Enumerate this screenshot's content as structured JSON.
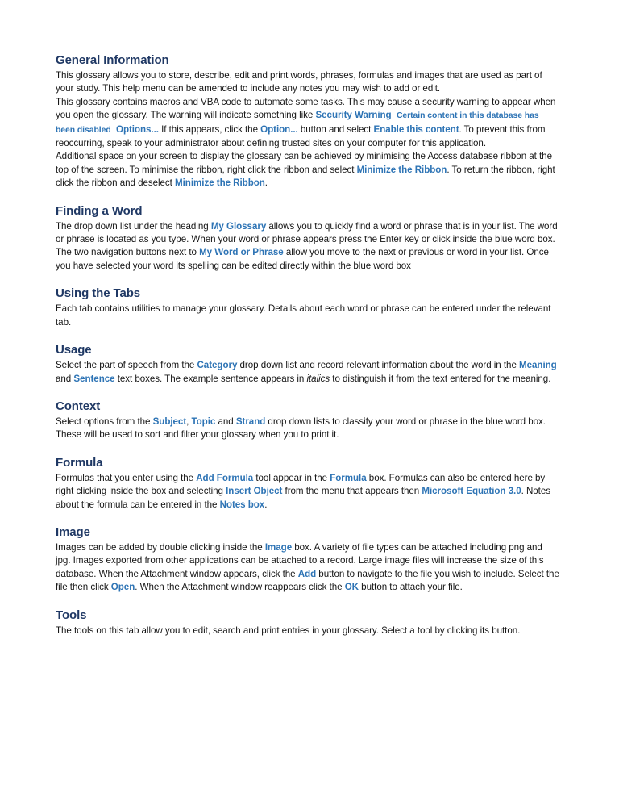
{
  "document": {
    "accent_color": "#2E74B5",
    "heading_color": "#1F3864",
    "body_color": "#161616",
    "background_color": "#FFFFFF",
    "sections": [
      {
        "heading": "General Information",
        "paragraphs": [
          {
            "runs": [
              {
                "text": "This glossary allows you to store, describe, edit and print words, phrases, formulas and images that are used as part of your study. This help menu can be amended to include any notes you may wish to add or edit.",
                "style": "normal"
              }
            ]
          },
          {
            "spaced": true,
            "runs": [
              {
                "text": "This glossary contains macros and VBA code to automate some tasks. This may cause a security warning to appear when you open the glossary. The warning will indicate something like ",
                "style": "normal"
              },
              {
                "text": "Security Warning",
                "style": "accent"
              },
              {
                "text": "  ",
                "style": "normal"
              },
              {
                "text": "Certain content in this database has been disabled",
                "style": "accent-small"
              },
              {
                "text": "  ",
                "style": "normal"
              },
              {
                "text": "Options...",
                "style": "accent"
              },
              {
                "text": " If this appears, click the ",
                "style": "normal"
              },
              {
                "text": "Option...",
                "style": "accent"
              },
              {
                "text": " button and select ",
                "style": "normal"
              },
              {
                "text": "Enable this content",
                "style": "accent"
              },
              {
                "text": ". To prevent this from reoccurring, speak to your administrator about defining trusted sites on your computer for this application.",
                "style": "normal"
              }
            ]
          },
          {
            "spaced": true,
            "runs": [
              {
                "text": "Additional space on your screen to display the glossary can be achieved by minimising the Access database ribbon at the top of the screen. To minimise the ribbon, right click the ribbon and select ",
                "style": "normal"
              },
              {
                "text": "Minimize the Ribbon",
                "style": "accent"
              },
              {
                "text": ". To return the ribbon, right click the ribbon and deselect ",
                "style": "normal"
              },
              {
                "text": "Minimize the Ribbon",
                "style": "accent"
              },
              {
                "text": ".",
                "style": "normal"
              }
            ]
          }
        ]
      },
      {
        "heading": "Finding a Word",
        "paragraphs": [
          {
            "runs": [
              {
                "text": "The drop down list under the heading ",
                "style": "normal"
              },
              {
                "text": "My Glossary",
                "style": "accent"
              },
              {
                "text": " allows you to quickly find a word or phrase that is in your list. The word or phrase is located as you type. When your word or phrase appears press the Enter key or click inside the blue word box. The two navigation buttons next to ",
                "style": "normal"
              },
              {
                "text": "My Word or Phrase",
                "style": "accent"
              },
              {
                "text": " allow you move to the next or previous or word in your list. Once you have selected your word its spelling can be edited directly within the blue word box",
                "style": "normal"
              }
            ]
          }
        ]
      },
      {
        "heading": "Using the Tabs",
        "paragraphs": [
          {
            "runs": [
              {
                "text": "Each tab contains utilities to manage your glossary. Details about each word or phrase can be entered under the relevant tab.",
                "style": "normal"
              }
            ]
          }
        ]
      },
      {
        "heading": "Usage",
        "paragraphs": [
          {
            "runs": [
              {
                "text": "Select the part of speech from the ",
                "style": "normal"
              },
              {
                "text": "Category",
                "style": "accent"
              },
              {
                "text": " drop down list and record relevant information about the word in the ",
                "style": "normal"
              },
              {
                "text": "Meaning",
                "style": "accent"
              },
              {
                "text": " and ",
                "style": "normal"
              },
              {
                "text": "Sentence",
                "style": "accent"
              },
              {
                "text": " text boxes. The example sentence appears in ",
                "style": "normal"
              },
              {
                "text": "italics",
                "style": "italic"
              },
              {
                "text": " to distinguish it from the text entered for the meaning.",
                "style": "normal"
              }
            ]
          }
        ]
      },
      {
        "heading": "Context",
        "paragraphs": [
          {
            "runs": [
              {
                "text": "Select options from the ",
                "style": "normal"
              },
              {
                "text": "Subject",
                "style": "accent"
              },
              {
                "text": ", ",
                "style": "normal"
              },
              {
                "text": "Topic",
                "style": "accent"
              },
              {
                "text": " and ",
                "style": "normal"
              },
              {
                "text": "Strand",
                "style": "accent"
              },
              {
                "text": " drop down lists to classify your word or phrase in the blue word box. These will be used to sort and filter your glossary when you to print it.",
                "style": "normal"
              }
            ]
          }
        ]
      },
      {
        "heading": "Formula",
        "paragraphs": [
          {
            "runs": [
              {
                "text": "Formulas that you enter using the ",
                "style": "normal"
              },
              {
                "text": "Add Formula",
                "style": "accent"
              },
              {
                "text": " tool appear in the ",
                "style": "normal"
              },
              {
                "text": "Formula",
                "style": "accent"
              },
              {
                "text": " box. Formulas can also be entered here by right clicking inside the box and selecting ",
                "style": "normal"
              },
              {
                "text": "Insert Object",
                "style": "accent"
              },
              {
                "text": " from the menu that appears then ",
                "style": "normal"
              },
              {
                "text": "Microsoft Equation 3.0",
                "style": "accent"
              },
              {
                "text": ". Notes about the formula can be entered in the ",
                "style": "normal"
              },
              {
                "text": "Notes box",
                "style": "accent"
              },
              {
                "text": ".",
                "style": "normal"
              }
            ]
          }
        ]
      },
      {
        "heading": "Image",
        "paragraphs": [
          {
            "runs": [
              {
                "text": "Images can be added by double clicking inside the ",
                "style": "normal"
              },
              {
                "text": "Image",
                "style": "accent"
              },
              {
                "text": " box. A variety of file types can be attached including png and jpg. Images exported from other applications can be attached to a record. Large image files will increase the size of this database. When the Attachment window appears, click the ",
                "style": "normal"
              },
              {
                "text": "Add",
                "style": "accent"
              },
              {
                "text": " button to navigate to the file you wish to include. Select the file then click ",
                "style": "normal"
              },
              {
                "text": "Open",
                "style": "accent"
              },
              {
                "text": ". When the Attachment window reappears click the ",
                "style": "normal"
              },
              {
                "text": "OK",
                "style": "accent"
              },
              {
                "text": " button to attach your file.",
                "style": "normal"
              }
            ]
          }
        ]
      },
      {
        "heading": "Tools",
        "paragraphs": [
          {
            "runs": [
              {
                "text": "The tools on this tab allow you to edit, search and print entries in your glossary. Select a tool by clicking its button.",
                "style": "normal"
              }
            ]
          }
        ]
      }
    ]
  }
}
